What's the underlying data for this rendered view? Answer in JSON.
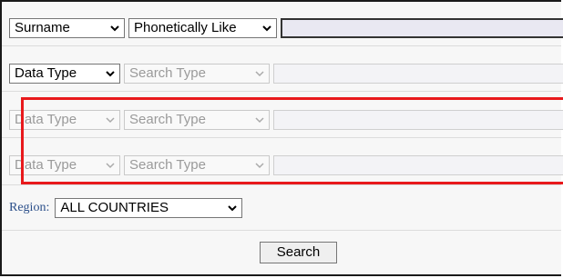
{
  "rows": [
    {
      "field": "Surname",
      "match": "Phonetically Like",
      "value": "",
      "enabled": true
    },
    {
      "field": "Data Type",
      "match": "Search Type",
      "value": "",
      "enabled": true
    },
    {
      "field": "Data Type",
      "match": "Search Type",
      "value": "",
      "enabled": false
    },
    {
      "field": "Data Type",
      "match": "Search Type",
      "value": "",
      "enabled": false
    }
  ],
  "region": {
    "label": "Region:",
    "value": "ALL COUNTRIES"
  },
  "search_button": "Search",
  "colors": {
    "highlight": "#e8191c",
    "region_label": "#2b4f8a"
  },
  "icons": {
    "dropdown": "chevron-down-icon"
  }
}
